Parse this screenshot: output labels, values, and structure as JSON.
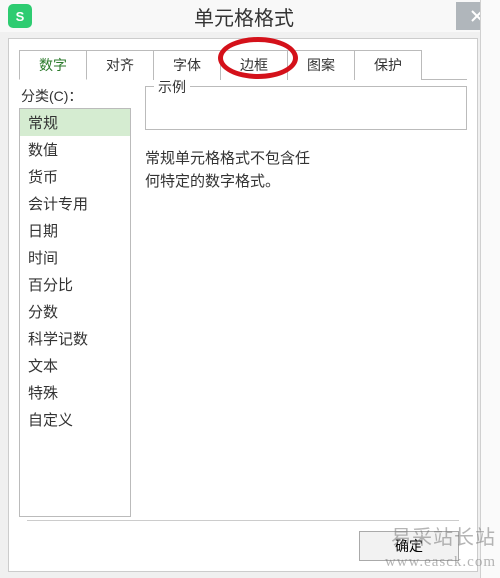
{
  "window": {
    "app_icon_letter": "S",
    "title": "单元格格式"
  },
  "tabs": [
    {
      "label": "数字",
      "active": true
    },
    {
      "label": "对齐",
      "active": false
    },
    {
      "label": "字体",
      "active": false
    },
    {
      "label": "边框",
      "active": false
    },
    {
      "label": "图案",
      "active": false
    },
    {
      "label": "保护",
      "active": false
    }
  ],
  "category": {
    "label": "分类(C)：",
    "items": [
      {
        "label": "常规",
        "selected": true
      },
      {
        "label": "数值",
        "selected": false
      },
      {
        "label": "货币",
        "selected": false
      },
      {
        "label": "会计专用",
        "selected": false
      },
      {
        "label": "日期",
        "selected": false
      },
      {
        "label": "时间",
        "selected": false
      },
      {
        "label": "百分比",
        "selected": false
      },
      {
        "label": "分数",
        "selected": false
      },
      {
        "label": "科学记数",
        "selected": false
      },
      {
        "label": "文本",
        "selected": false
      },
      {
        "label": "特殊",
        "selected": false
      },
      {
        "label": "自定义",
        "selected": false
      }
    ]
  },
  "example": {
    "label": "示例",
    "value": ""
  },
  "description": {
    "line1": "常规单元格格式不包含任",
    "line2": "何特定的数字格式。"
  },
  "buttons": {
    "ok": "确定"
  },
  "annotation": {
    "highlighted_tab": "边框"
  },
  "watermark": {
    "line1": "易采站长站",
    "line2": "www.easck.com"
  }
}
